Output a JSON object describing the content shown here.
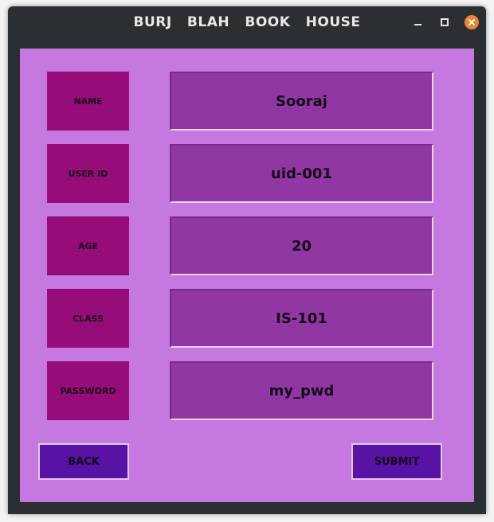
{
  "window": {
    "title": "BURJ   BLAH   BOOK   HOUSE"
  },
  "form": {
    "rows": [
      {
        "label": "NAME",
        "value": "Sooraj"
      },
      {
        "label": "USER ID",
        "value": "uid-001"
      },
      {
        "label": "AGE",
        "value": "20"
      },
      {
        "label": "CLASS",
        "value": "IS-101"
      },
      {
        "label": "PASSWORD",
        "value": "my_pwd"
      }
    ]
  },
  "actions": {
    "back_label": "BACK",
    "submit_label": "SUBMIT"
  },
  "colors": {
    "background": "#c478e0",
    "label_box": "#960c79",
    "field": "#9037a4",
    "button": "#5812a4",
    "close_button": "#f0842c"
  }
}
